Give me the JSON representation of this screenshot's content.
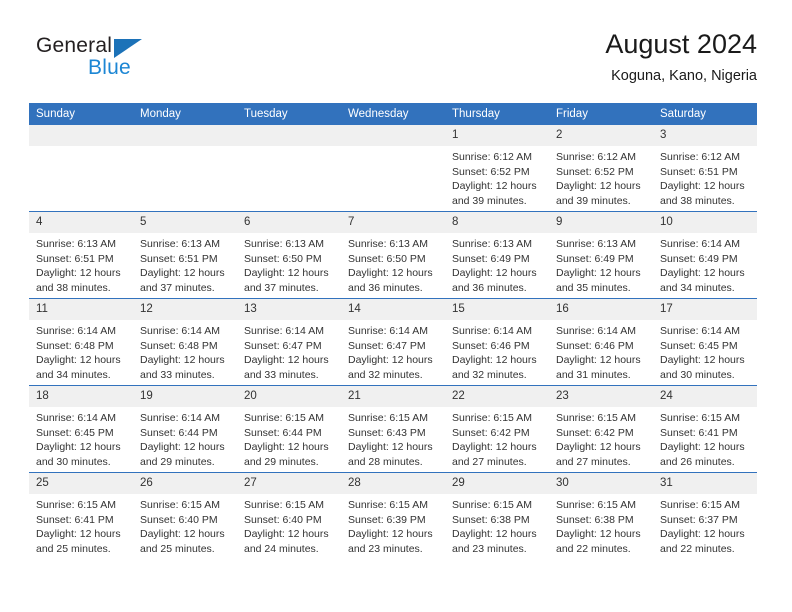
{
  "brand": {
    "name_part1": "General",
    "name_part2": "Blue",
    "logo_icon": "triangle-logo-icon"
  },
  "header": {
    "title": "August 2024",
    "subtitle": "Koguna, Kano, Nigeria"
  },
  "colors": {
    "header_blue": "#3272bd",
    "brand_blue": "#1c86d4",
    "logo_blue": "#1c72b8",
    "daynum_band": "#f0f0f0",
    "text": "#333333"
  },
  "weekdays": [
    "Sunday",
    "Monday",
    "Tuesday",
    "Wednesday",
    "Thursday",
    "Friday",
    "Saturday"
  ],
  "weeks": [
    [
      {
        "day": "",
        "lines": []
      },
      {
        "day": "",
        "lines": []
      },
      {
        "day": "",
        "lines": []
      },
      {
        "day": "",
        "lines": []
      },
      {
        "day": "1",
        "lines": [
          "Sunrise: 6:12 AM",
          "Sunset: 6:52 PM",
          "Daylight: 12 hours",
          "and 39 minutes."
        ]
      },
      {
        "day": "2",
        "lines": [
          "Sunrise: 6:12 AM",
          "Sunset: 6:52 PM",
          "Daylight: 12 hours",
          "and 39 minutes."
        ]
      },
      {
        "day": "3",
        "lines": [
          "Sunrise: 6:12 AM",
          "Sunset: 6:51 PM",
          "Daylight: 12 hours",
          "and 38 minutes."
        ]
      }
    ],
    [
      {
        "day": "4",
        "lines": [
          "Sunrise: 6:13 AM",
          "Sunset: 6:51 PM",
          "Daylight: 12 hours",
          "and 38 minutes."
        ]
      },
      {
        "day": "5",
        "lines": [
          "Sunrise: 6:13 AM",
          "Sunset: 6:51 PM",
          "Daylight: 12 hours",
          "and 37 minutes."
        ]
      },
      {
        "day": "6",
        "lines": [
          "Sunrise: 6:13 AM",
          "Sunset: 6:50 PM",
          "Daylight: 12 hours",
          "and 37 minutes."
        ]
      },
      {
        "day": "7",
        "lines": [
          "Sunrise: 6:13 AM",
          "Sunset: 6:50 PM",
          "Daylight: 12 hours",
          "and 36 minutes."
        ]
      },
      {
        "day": "8",
        "lines": [
          "Sunrise: 6:13 AM",
          "Sunset: 6:49 PM",
          "Daylight: 12 hours",
          "and 36 minutes."
        ]
      },
      {
        "day": "9",
        "lines": [
          "Sunrise: 6:13 AM",
          "Sunset: 6:49 PM",
          "Daylight: 12 hours",
          "and 35 minutes."
        ]
      },
      {
        "day": "10",
        "lines": [
          "Sunrise: 6:14 AM",
          "Sunset: 6:49 PM",
          "Daylight: 12 hours",
          "and 34 minutes."
        ]
      }
    ],
    [
      {
        "day": "11",
        "lines": [
          "Sunrise: 6:14 AM",
          "Sunset: 6:48 PM",
          "Daylight: 12 hours",
          "and 34 minutes."
        ]
      },
      {
        "day": "12",
        "lines": [
          "Sunrise: 6:14 AM",
          "Sunset: 6:48 PM",
          "Daylight: 12 hours",
          "and 33 minutes."
        ]
      },
      {
        "day": "13",
        "lines": [
          "Sunrise: 6:14 AM",
          "Sunset: 6:47 PM",
          "Daylight: 12 hours",
          "and 33 minutes."
        ]
      },
      {
        "day": "14",
        "lines": [
          "Sunrise: 6:14 AM",
          "Sunset: 6:47 PM",
          "Daylight: 12 hours",
          "and 32 minutes."
        ]
      },
      {
        "day": "15",
        "lines": [
          "Sunrise: 6:14 AM",
          "Sunset: 6:46 PM",
          "Daylight: 12 hours",
          "and 32 minutes."
        ]
      },
      {
        "day": "16",
        "lines": [
          "Sunrise: 6:14 AM",
          "Sunset: 6:46 PM",
          "Daylight: 12 hours",
          "and 31 minutes."
        ]
      },
      {
        "day": "17",
        "lines": [
          "Sunrise: 6:14 AM",
          "Sunset: 6:45 PM",
          "Daylight: 12 hours",
          "and 30 minutes."
        ]
      }
    ],
    [
      {
        "day": "18",
        "lines": [
          "Sunrise: 6:14 AM",
          "Sunset: 6:45 PM",
          "Daylight: 12 hours",
          "and 30 minutes."
        ]
      },
      {
        "day": "19",
        "lines": [
          "Sunrise: 6:14 AM",
          "Sunset: 6:44 PM",
          "Daylight: 12 hours",
          "and 29 minutes."
        ]
      },
      {
        "day": "20",
        "lines": [
          "Sunrise: 6:15 AM",
          "Sunset: 6:44 PM",
          "Daylight: 12 hours",
          "and 29 minutes."
        ]
      },
      {
        "day": "21",
        "lines": [
          "Sunrise: 6:15 AM",
          "Sunset: 6:43 PM",
          "Daylight: 12 hours",
          "and 28 minutes."
        ]
      },
      {
        "day": "22",
        "lines": [
          "Sunrise: 6:15 AM",
          "Sunset: 6:42 PM",
          "Daylight: 12 hours",
          "and 27 minutes."
        ]
      },
      {
        "day": "23",
        "lines": [
          "Sunrise: 6:15 AM",
          "Sunset: 6:42 PM",
          "Daylight: 12 hours",
          "and 27 minutes."
        ]
      },
      {
        "day": "24",
        "lines": [
          "Sunrise: 6:15 AM",
          "Sunset: 6:41 PM",
          "Daylight: 12 hours",
          "and 26 minutes."
        ]
      }
    ],
    [
      {
        "day": "25",
        "lines": [
          "Sunrise: 6:15 AM",
          "Sunset: 6:41 PM",
          "Daylight: 12 hours",
          "and 25 minutes."
        ]
      },
      {
        "day": "26",
        "lines": [
          "Sunrise: 6:15 AM",
          "Sunset: 6:40 PM",
          "Daylight: 12 hours",
          "and 25 minutes."
        ]
      },
      {
        "day": "27",
        "lines": [
          "Sunrise: 6:15 AM",
          "Sunset: 6:40 PM",
          "Daylight: 12 hours",
          "and 24 minutes."
        ]
      },
      {
        "day": "28",
        "lines": [
          "Sunrise: 6:15 AM",
          "Sunset: 6:39 PM",
          "Daylight: 12 hours",
          "and 23 minutes."
        ]
      },
      {
        "day": "29",
        "lines": [
          "Sunrise: 6:15 AM",
          "Sunset: 6:38 PM",
          "Daylight: 12 hours",
          "and 23 minutes."
        ]
      },
      {
        "day": "30",
        "lines": [
          "Sunrise: 6:15 AM",
          "Sunset: 6:38 PM",
          "Daylight: 12 hours",
          "and 22 minutes."
        ]
      },
      {
        "day": "31",
        "lines": [
          "Sunrise: 6:15 AM",
          "Sunset: 6:37 PM",
          "Daylight: 12 hours",
          "and 22 minutes."
        ]
      }
    ]
  ]
}
